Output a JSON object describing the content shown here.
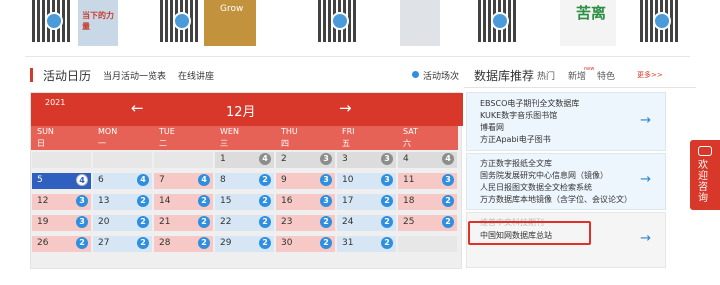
{
  "top_strip": {
    "items": [
      "qr-code",
      "book-cover",
      "qr-code",
      "book-cover",
      "qr-code",
      "book-cover",
      "qr-code",
      "book-cover",
      "qr-code"
    ]
  },
  "calendar_section": {
    "title": "活动日历",
    "tabs": [
      "当月活动一览表",
      "在线讲座"
    ],
    "legend": "活动场次",
    "year": "2021",
    "month": "12月",
    "prev_arrow": "←",
    "next_arrow": "→",
    "weekdays": [
      {
        "en": "SUN",
        "cn": "日"
      },
      {
        "en": "MON",
        "cn": "一"
      },
      {
        "en": "TUE",
        "cn": "二"
      },
      {
        "en": "WEN",
        "cn": "三"
      },
      {
        "en": "THU",
        "cn": "四"
      },
      {
        "en": "FRI",
        "cn": "五"
      },
      {
        "en": "SAT",
        "cn": "六"
      }
    ],
    "weeks": [
      [
        {
          "d": "",
          "c": ""
        },
        {
          "d": "",
          "c": ""
        },
        {
          "d": "",
          "c": ""
        },
        {
          "d": "1",
          "c": "4"
        },
        {
          "d": "2",
          "c": "3"
        },
        {
          "d": "3",
          "c": "3"
        },
        {
          "d": "4",
          "c": "4"
        }
      ],
      [
        {
          "d": "5",
          "c": "4"
        },
        {
          "d": "6",
          "c": "4"
        },
        {
          "d": "7",
          "c": "4"
        },
        {
          "d": "8",
          "c": "2"
        },
        {
          "d": "9",
          "c": "3"
        },
        {
          "d": "10",
          "c": "3"
        },
        {
          "d": "11",
          "c": "3"
        }
      ],
      [
        {
          "d": "12",
          "c": "3"
        },
        {
          "d": "13",
          "c": "2"
        },
        {
          "d": "14",
          "c": "2"
        },
        {
          "d": "15",
          "c": "2"
        },
        {
          "d": "16",
          "c": "3"
        },
        {
          "d": "17",
          "c": "2"
        },
        {
          "d": "18",
          "c": "2"
        }
      ],
      [
        {
          "d": "19",
          "c": "3"
        },
        {
          "d": "20",
          "c": "2"
        },
        {
          "d": "21",
          "c": "2"
        },
        {
          "d": "22",
          "c": "2"
        },
        {
          "d": "23",
          "c": "2"
        },
        {
          "d": "24",
          "c": "2"
        },
        {
          "d": "25",
          "c": "2"
        }
      ],
      [
        {
          "d": "26",
          "c": "2"
        },
        {
          "d": "27",
          "c": "2"
        },
        {
          "d": "28",
          "c": "2"
        },
        {
          "d": "29",
          "c": "2"
        },
        {
          "d": "30",
          "c": "2"
        },
        {
          "d": "31",
          "c": "2"
        },
        {
          "d": "",
          "c": ""
        }
      ]
    ]
  },
  "database_section": {
    "title": "数据库推荐",
    "tabs": [
      "热门",
      "新增",
      "特色"
    ],
    "new_badge": "new",
    "more": "更多>>",
    "groups": [
      {
        "items": [
          "EBSCO电子期刊全文数据库",
          "KUKE数字音乐图书馆",
          "博看网",
          "方正Apabi电子图书"
        ]
      },
      {
        "items": [
          "方正数字报纸全文库",
          "国务院发展研究中心信息网（镜像）",
          "人民日报图文数据全文检索系统",
          "万方数据库本地镜像（含学位、会议论文）"
        ]
      },
      {
        "items": [
          "维普中文科技期刊",
          "中国知网数据库总站"
        ]
      }
    ],
    "go_arrow": "→"
  },
  "float_tab": {
    "label": "欢迎咨询"
  },
  "colors": {
    "accent": "#d7382a",
    "blue": "#2e8fe0",
    "grey": "#8d8d8d"
  }
}
